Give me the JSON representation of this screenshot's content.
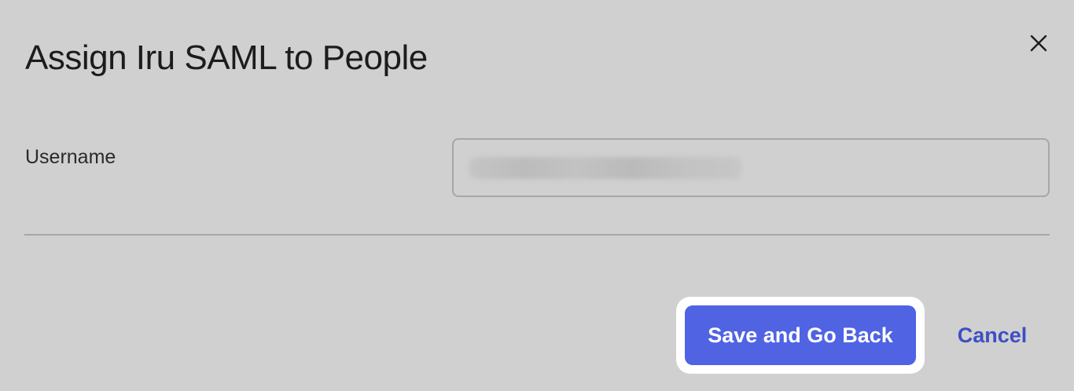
{
  "dialog": {
    "title": "Assign Iru SAML to People",
    "close_icon": "close-icon"
  },
  "form": {
    "username_label": "Username",
    "username_value_obscured": true
  },
  "actions": {
    "save_label": "Save and Go Back",
    "cancel_label": "Cancel"
  },
  "colors": {
    "background": "#d0d0d0",
    "primary_button": "#4f63e3",
    "link": "#3e4fc4",
    "focus_ring": "#ffffff"
  }
}
